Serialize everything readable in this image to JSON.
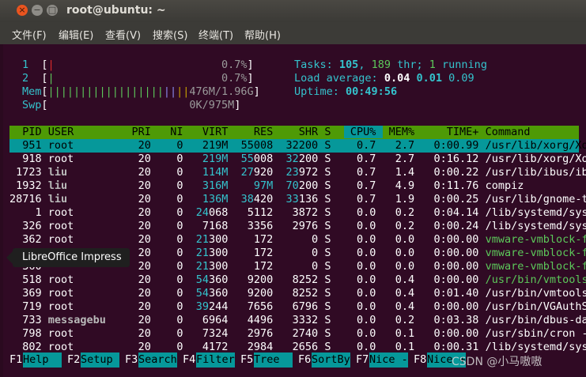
{
  "window": {
    "title": "root@ubuntu: ~"
  },
  "menu": [
    "文件(F)",
    "编辑(E)",
    "查看(V)",
    "搜索(S)",
    "终端(T)",
    "帮助(H)"
  ],
  "meters": {
    "cpu1_label": "1",
    "cpu1_pct": "0.7%",
    "cpu2_label": "2",
    "cpu2_pct": "0.7%",
    "mem_label": "Mem",
    "mem_bar": "||||||||||||||||||",
    "mem_value": "476M/1.96G",
    "swp_label": "Swp",
    "swp_value": "0K/975M"
  },
  "stats": {
    "tasks_label": "Tasks:",
    "tasks": "105",
    "thr": "189",
    "thr_label": "thr;",
    "running": "1",
    "running_label": "running",
    "load_label": "Load average:",
    "load1": "0.04",
    "load5": "0.01",
    "load15": "0.09",
    "uptime_label": "Uptime:",
    "uptime": "00:49:56"
  },
  "columns": [
    "PID",
    "USER",
    "PRI",
    "NI",
    "VIRT",
    "RES",
    "SHR",
    "S",
    "CPU%",
    "MEM%",
    "TIME+",
    "Command"
  ],
  "processes": [
    {
      "pid": "951",
      "user": "root",
      "pri": "20",
      "ni": "0",
      "virt": "219M",
      "res": "55008",
      "shr": "32200",
      "s": "S",
      "cpu": "0.7",
      "mem": "2.7",
      "time": "0:00.99",
      "cmd": "/usr/lib/xorg/Xor"
    },
    {
      "pid": "918",
      "user": "root",
      "pri": "20",
      "ni": "0",
      "virt": "219M",
      "res": "55008",
      "shr": "32200",
      "s": "S",
      "cpu": "0.7",
      "mem": "2.7",
      "time": "0:16.12",
      "cmd": "/usr/lib/xorg/Xor"
    },
    {
      "pid": "1723",
      "user": "liu",
      "pri": "20",
      "ni": "0",
      "virt": "114M",
      "res": "27920",
      "shr": "23972",
      "s": "S",
      "cpu": "0.7",
      "mem": "1.4",
      "time": "0:00.22",
      "cmd": "/usr/lib/ibus/ibu"
    },
    {
      "pid": "1932",
      "user": "liu",
      "pri": "20",
      "ni": "0",
      "virt": "316M",
      "res": "97M",
      "shr": "70200",
      "s": "S",
      "cpu": "0.7",
      "mem": "4.9",
      "time": "0:11.76",
      "cmd": "compiz"
    },
    {
      "pid": "28716",
      "user": "liu",
      "pri": "20",
      "ni": "0",
      "virt": "136M",
      "res": "38420",
      "shr": "33136",
      "s": "S",
      "cpu": "0.7",
      "mem": "1.9",
      "time": "0:00.25",
      "cmd": "/usr/lib/gnome-te"
    },
    {
      "pid": "1",
      "user": "root",
      "pri": "20",
      "ni": "0",
      "virt": "24068",
      "res": "5112",
      "shr": "3872",
      "s": "S",
      "cpu": "0.0",
      "mem": "0.2",
      "time": "0:04.14",
      "cmd": "/lib/systemd/syst"
    },
    {
      "pid": "326",
      "user": "root",
      "pri": "20",
      "ni": "0",
      "virt": "7168",
      "res": "3356",
      "shr": "2976",
      "s": "S",
      "cpu": "0.0",
      "mem": "0.2",
      "time": "0:00.24",
      "cmd": "/lib/systemd/syst"
    },
    {
      "pid": "362",
      "user": "root",
      "pri": "20",
      "ni": "0",
      "virt": "21300",
      "res": "172",
      "shr": "0",
      "s": "S",
      "cpu": "0.0",
      "mem": "0.0",
      "time": "0:00.00",
      "cmd": "vmware-vmblock-fu"
    },
    {
      "pid": "",
      "user": "",
      "pri": "20",
      "ni": "0",
      "virt": "21300",
      "res": "172",
      "shr": "0",
      "s": "S",
      "cpu": "0.0",
      "mem": "0.0",
      "time": "0:00.00",
      "cmd": "vmware-vmblock-fu"
    },
    {
      "pid": "360",
      "user": "",
      "pri": "20",
      "ni": "0",
      "virt": "21300",
      "res": "172",
      "shr": "0",
      "s": "S",
      "cpu": "0.0",
      "mem": "0.0",
      "time": "0:00.00",
      "cmd": "vmware-vmblock-fu"
    },
    {
      "pid": "518",
      "user": "root",
      "pri": "20",
      "ni": "0",
      "virt": "54360",
      "res": "9200",
      "shr": "8252",
      "s": "S",
      "cpu": "0.0",
      "mem": "0.4",
      "time": "0:00.00",
      "cmd": "/usr/bin/vmtoolsd"
    },
    {
      "pid": "369",
      "user": "root",
      "pri": "20",
      "ni": "0",
      "virt": "54360",
      "res": "9200",
      "shr": "8252",
      "s": "S",
      "cpu": "0.0",
      "mem": "0.4",
      "time": "0:01.40",
      "cmd": "/usr/bin/vmtoolsd"
    },
    {
      "pid": "719",
      "user": "root",
      "pri": "20",
      "ni": "0",
      "virt": "39244",
      "res": "7656",
      "shr": "6796",
      "s": "S",
      "cpu": "0.0",
      "mem": "0.4",
      "time": "0:00.00",
      "cmd": "/usr/bin/VGAuthSe"
    },
    {
      "pid": "733",
      "user": "messagebu",
      "pri": "20",
      "ni": "0",
      "virt": "6964",
      "res": "4496",
      "shr": "3332",
      "s": "S",
      "cpu": "0.0",
      "mem": "0.2",
      "time": "0:03.38",
      "cmd": "/usr/bin/dbus-dae"
    },
    {
      "pid": "798",
      "user": "root",
      "pri": "20",
      "ni": "0",
      "virt": "7324",
      "res": "2976",
      "shr": "2740",
      "s": "S",
      "cpu": "0.0",
      "mem": "0.1",
      "time": "0:00.00",
      "cmd": "/usr/sbin/cron -f"
    },
    {
      "pid": "802",
      "user": "root",
      "pri": "20",
      "ni": "0",
      "virt": "4172",
      "res": "2984",
      "shr": "2656",
      "s": "S",
      "cpu": "0.0",
      "mem": "0.1",
      "time": "0:00.31",
      "cmd": "/lib/systemd/syst"
    }
  ],
  "fkeys": [
    {
      "num": "F1",
      "label": "Help  "
    },
    {
      "num": "F2",
      "label": "Setup "
    },
    {
      "num": "F3",
      "label": "Search"
    },
    {
      "num": "F4",
      "label": "Filter"
    },
    {
      "num": "F5",
      "label": "Tree  "
    },
    {
      "num": "F6",
      "label": "SortBy"
    },
    {
      "num": "F7",
      "label": "Nice -"
    },
    {
      "num": "F8",
      "label": "Nice +"
    }
  ],
  "tooltip": "LibreOffice Impress",
  "watermark": "CSDN @小马嗷嗷",
  "colors": {
    "terminal_bg": "#300a24",
    "header_bg": "#4e9a06",
    "selected_bg": "#06989a",
    "cyan": "#34c3cd",
    "green": "#5cc85a",
    "accent_close": "#e9541f"
  }
}
